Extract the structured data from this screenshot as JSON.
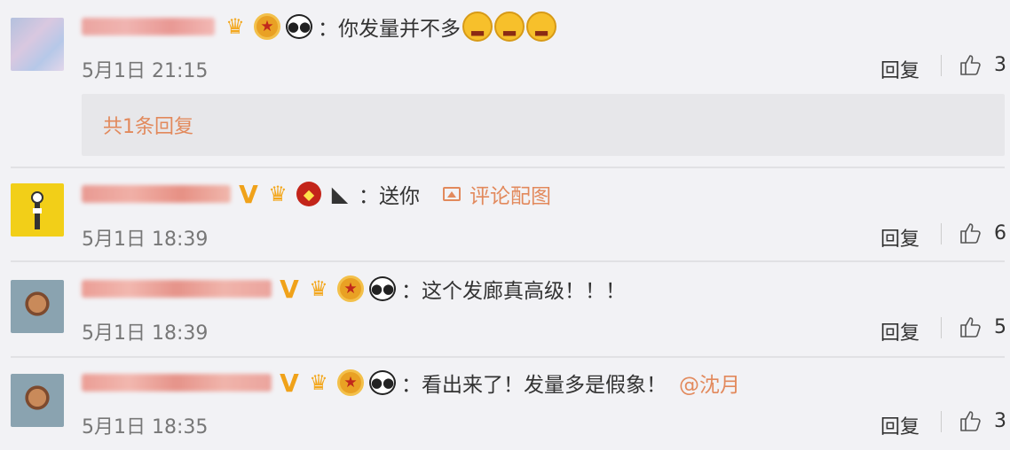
{
  "comments": [
    {
      "text": "你发量并不多",
      "emoji_count": 3,
      "badges": [
        "crown-level-icon",
        "medal-icon",
        "panda-icon"
      ],
      "time": "5月1日 21:15",
      "reply_label": "回复",
      "likes": "3",
      "thread_label": "共1条回复"
    },
    {
      "text": "送你",
      "badges": [
        "verified-v-icon",
        "crown-level-icon",
        "hero-mask-icon",
        "watermelon-icon"
      ],
      "pic_label": "评论配图",
      "time": "5月1日 18:39",
      "reply_label": "回复",
      "likes": "6"
    },
    {
      "text": "这个发廊真高级！！！",
      "badges": [
        "verified-v-icon",
        "crown-level-icon",
        "medal-icon",
        "panda-icon"
      ],
      "time": "5月1日 18:39",
      "reply_label": "回复",
      "likes": "5"
    },
    {
      "text": "看出来了！发量多是假象！",
      "mention": "@沈月",
      "badges": [
        "verified-v-icon",
        "crown-level-icon",
        "medal-icon",
        "panda-icon"
      ],
      "time": "5月1日 18:35",
      "reply_label": "回复",
      "likes": "3"
    }
  ],
  "colors": {
    "background": "#f2f2f5",
    "link": "#e2895c",
    "username_blur": "#e36a5a"
  }
}
